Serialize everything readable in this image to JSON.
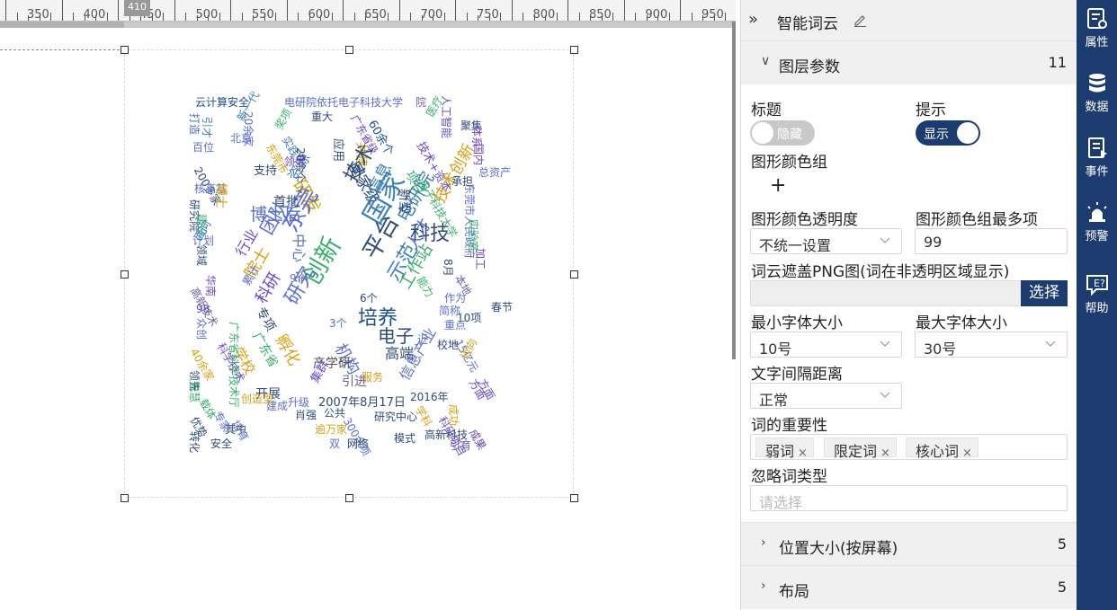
{
  "ruler": {
    "labels": [
      "350",
      "400",
      "450",
      "500",
      "550",
      "600",
      "650",
      "700",
      "750",
      "800",
      "850",
      "900",
      "950"
    ],
    "marker": "410"
  },
  "wordcloud": {
    "words": [
      {
        "t": "云计算安全",
        "c": "#1c4f8c"
      },
      {
        "t": "电研院依托电子科技大学",
        "c": "#5b6fd0"
      },
      {
        "t": "院",
        "c": "#6c5fa8"
      },
      {
        "t": "打造",
        "c": "#4a6fc8"
      },
      {
        "t": "人工智能",
        "c": "#6a48c8"
      },
      {
        "t": "新一代",
        "c": "#3c7fb8"
      },
      {
        "t": "重大",
        "c": "#2e4a7a"
      },
      {
        "t": "广东省级",
        "c": "#6a48c8"
      },
      {
        "t": "奖项",
        "c": "#3aaf6b"
      },
      {
        "t": "引才",
        "c": "#3c7fb8"
      },
      {
        "t": "医疗",
        "c": "#3aaf6b"
      },
      {
        "t": "60余个",
        "c": "#1c4f8c"
      },
      {
        "t": "技术+资本",
        "c": "#6a48c8"
      },
      {
        "t": "20余家",
        "c": "#5b6fd0"
      },
      {
        "t": "北京",
        "c": "#5b6fd0"
      },
      {
        "t": "应用",
        "c": "#2e4a7a"
      },
      {
        "t": "共建",
        "c": "#d4a017"
      },
      {
        "t": "国家级",
        "c": "#2e4a7a"
      },
      {
        "t": "研发",
        "c": "#d4a017"
      },
      {
        "t": "技术",
        "c": "#2e4a7a"
      },
      {
        "t": "东莞",
        "c": "#5b6fd0"
      },
      {
        "t": "博士后",
        "c": "#5b6fd0"
      },
      {
        "t": "平台",
        "c": "#2e4a7a"
      },
      {
        "t": "国家",
        "c": "#3c7fb8"
      },
      {
        "t": "电研院",
        "c": "#3c7fb8"
      },
      {
        "t": "示范",
        "c": "#3c7fb8"
      },
      {
        "t": "人才",
        "c": "#5b6fd0"
      },
      {
        "t": "创新",
        "c": "#3aaf6b"
      },
      {
        "t": "研究",
        "c": "#5b6fd0"
      },
      {
        "t": "中心",
        "c": "#5b6fd0"
      },
      {
        "t": "培养",
        "c": "#1c4f8c"
      },
      {
        "t": "工作站",
        "c": "#3aaf6b"
      },
      {
        "t": "电子",
        "c": "#2e4a7a"
      },
      {
        "t": "孵化",
        "c": "#d4a017"
      },
      {
        "t": "科研",
        "c": "#6a48c8"
      },
      {
        "t": "院士",
        "c": "#d4a017"
      },
      {
        "t": "机构",
        "c": "#5b6fd0"
      },
      {
        "t": "高端",
        "c": "#2e4a7a"
      },
      {
        "t": "信息产业",
        "c": "#5b6fd0"
      },
      {
        "t": "产学研",
        "c": "#555555"
      },
      {
        "t": "引进",
        "c": "#6c5fa8"
      },
      {
        "t": "开展",
        "c": "#2e4a7a"
      },
      {
        "t": "集群",
        "c": "#6a48c8"
      },
      {
        "t": "2007年8月17日",
        "c": "#2e4a7a"
      },
      {
        "t": "升级",
        "c": "#5b6fd0"
      },
      {
        "t": "肖强",
        "c": "#2e4a7a"
      },
      {
        "t": "公共",
        "c": "#2e4a7a"
      },
      {
        "t": "研究中心",
        "c": "#2e4a7a"
      },
      {
        "t": "建成",
        "c": "#5b6fd0"
      },
      {
        "t": "逾万家",
        "c": "#d4a017"
      },
      {
        "t": "300余项",
        "c": "#5b6fd0"
      },
      {
        "t": "网络",
        "c": "#2e4a7a"
      },
      {
        "t": "模式",
        "c": "#2e4a7a"
      },
      {
        "t": "引育",
        "c": "#6c5fa8"
      },
      {
        "t": "安全",
        "c": "#2e4a7a"
      },
      {
        "t": "其中",
        "c": "#2e4a7a"
      },
      {
        "t": "转化",
        "c": "#2e4a7a"
      },
      {
        "t": "优势",
        "c": "#2e4a7a"
      },
      {
        "t": "双",
        "c": "#5b6fd0"
      },
      {
        "t": "高新技术",
        "c": "#6c5fa8"
      },
      {
        "t": "科技",
        "c": "#2e4a7a"
      },
      {
        "t": "信息",
        "c": "#3c7fb8"
      },
      {
        "t": "首批",
        "c": "#2e4a7a"
      },
      {
        "t": "行业",
        "c": "#6a48c8"
      },
      {
        "t": "广东省",
        "c": "#3aaf6b"
      },
      {
        "t": "学校",
        "c": "#d4a017"
      },
      {
        "t": "专项",
        "c": "#2e4a7a"
      },
      {
        "t": "累计",
        "c": "#5b6fd0"
      },
      {
        "t": "团队",
        "c": "#5b6fd0"
      },
      {
        "t": "资源",
        "c": "#3c7fb8"
      },
      {
        "t": "项目",
        "c": "#3aaf6b"
      },
      {
        "t": "新型",
        "c": "#2e4a7a"
      },
      {
        "t": "技术创新",
        "c": "#d4a017"
      },
      {
        "t": "电子科技大学",
        "c": "#3aaf6b"
      },
      {
        "t": "承担",
        "c": "#2e4a7a"
      },
      {
        "t": "东莞市人民政府",
        "c": "#5b6fd0"
      },
      {
        "t": "实验室",
        "c": "#3aaf6b"
      },
      {
        "t": "加工",
        "c": "#6a48c8"
      },
      {
        "t": "8月",
        "c": "#2e4a7a"
      },
      {
        "t": "本地",
        "c": "#6c5fa8"
      },
      {
        "t": "简称",
        "c": "#5b6fd0"
      },
      {
        "t": "10项",
        "c": "#2e4a7a"
      },
      {
        "t": "重点",
        "c": "#5b6fd0"
      },
      {
        "t": "校地",
        "c": "#2e4a7a"
      },
      {
        "t": "15亿元",
        "c": "#5b6fd0"
      },
      {
        "t": "近",
        "c": "#5b6fd0"
      },
      {
        "t": "迈向",
        "c": "#d4a017"
      },
      {
        "t": "方面",
        "c": "#6a48c8"
      },
      {
        "t": "成果",
        "c": "#6a48c8"
      },
      {
        "t": "高新科技",
        "c": "#2e4a7a"
      },
      {
        "t": "科研项目",
        "c": "#6a48c8"
      },
      {
        "t": "成功",
        "c": "#d4a017"
      },
      {
        "t": "2016年",
        "c": "#2e4a7a"
      },
      {
        "t": "学科",
        "c": "#d4a017"
      },
      {
        "t": "研究院",
        "c": "#2e4a7a"
      },
      {
        "t": "建设",
        "c": "#3aaf6b"
      },
      {
        "t": "领域",
        "c": "#2e4a7a"
      },
      {
        "t": "计划",
        "c": "#5b6fd0"
      },
      {
        "t": "华南",
        "c": "#6a48c8"
      },
      {
        "t": "众创",
        "c": "#5b6fd0"
      },
      {
        "t": "科学技术",
        "c": "#6a48c8"
      },
      {
        "t": "40余家",
        "c": "#d4a017"
      },
      {
        "t": "领先",
        "c": "#2e4a7a"
      },
      {
        "t": "智慧",
        "c": "#3aaf6b"
      },
      {
        "t": "载体",
        "c": "#3aaf6b"
      },
      {
        "t": "专家",
        "c": "#5b6fd0"
      },
      {
        "t": "创造型",
        "c": "#d4a017"
      },
      {
        "t": "培育",
        "c": "#5b6fd0"
      },
      {
        "t": "百位",
        "c": "#5b6fd0"
      },
      {
        "t": "200多家",
        "c": "#2e4a7a"
      },
      {
        "t": "核高基",
        "c": "#5b6fd0"
      },
      {
        "t": "博士",
        "c": "#d4a017"
      },
      {
        "t": "支持",
        "c": "#2e4a7a"
      },
      {
        "t": "实践",
        "c": "#3c7fb8"
      },
      {
        "t": "20余个",
        "c": "#2e4a7a"
      },
      {
        "t": "东莞市",
        "c": "#d4a017"
      },
      {
        "t": "方面",
        "c": "#6a48c8"
      },
      {
        "t": "国内",
        "c": "#6a48c8"
      },
      {
        "t": "总资产",
        "c": "#5b6fd0"
      },
      {
        "t": "领导",
        "c": "#6a48c8"
      },
      {
        "t": "聚集",
        "c": "#2e4a7a"
      },
      {
        "t": "6个",
        "c": "#2e4a7a"
      },
      {
        "t": "3个",
        "c": "#5b6fd0"
      },
      {
        "t": "9个",
        "c": "#5b6fd0"
      },
      {
        "t": "98",
        "c": "#6a48c8"
      },
      {
        "t": "作为",
        "c": "#5b6fd0"
      },
      {
        "t": "春节",
        "c": "#2e4a7a"
      },
      {
        "t": "体系",
        "c": "#6a48c8"
      },
      {
        "t": "能力",
        "c": "#3aaf6b"
      },
      {
        "t": "广东省科学技术厅",
        "c": "#3aaf6b"
      },
      {
        "t": "服务",
        "c": "#d4a017"
      },
      {
        "t": "面向",
        "c": "#3c7fb8"
      }
    ]
  },
  "panel": {
    "title": "智能词云",
    "section_layer": {
      "title": "图层参数",
      "count": "11"
    },
    "label_title": "标题",
    "label_hint": "提示",
    "toggle_hide": "隐藏",
    "toggle_show": "显示",
    "label_color_group": "图形颜色组",
    "plus": "+",
    "label_opacity": "图形颜色透明度",
    "opacity_value": "不统一设置",
    "label_max_items": "图形颜色组最多项",
    "max_items_value": "99",
    "label_mask": "词云遮盖PNG图(词在非透明区域显示)",
    "choose_button": "选择",
    "label_min_font": "最小字体大小",
    "min_font_value": "10号",
    "label_max_font": "最大字体大小",
    "max_font_value": "30号",
    "label_spacing": "文字间隔距离",
    "spacing_value": "正常",
    "label_importance": "词的重要性",
    "importance_tags": [
      "弱词",
      "限定词",
      "核心词"
    ],
    "label_ignore": "忽略词类型",
    "ignore_placeholder": "请选择",
    "section_position": {
      "title": "位置大小(按屏幕)",
      "count": "5"
    },
    "section_layout": {
      "title": "布局",
      "count": "5"
    }
  },
  "sidenav": {
    "items": [
      {
        "label": "属性",
        "icon": "property-icon"
      },
      {
        "label": "数据",
        "icon": "database-icon"
      },
      {
        "label": "事件",
        "icon": "event-icon"
      },
      {
        "label": "预警",
        "icon": "alarm-icon"
      },
      {
        "label": "帮助",
        "icon": "help-icon"
      }
    ]
  }
}
